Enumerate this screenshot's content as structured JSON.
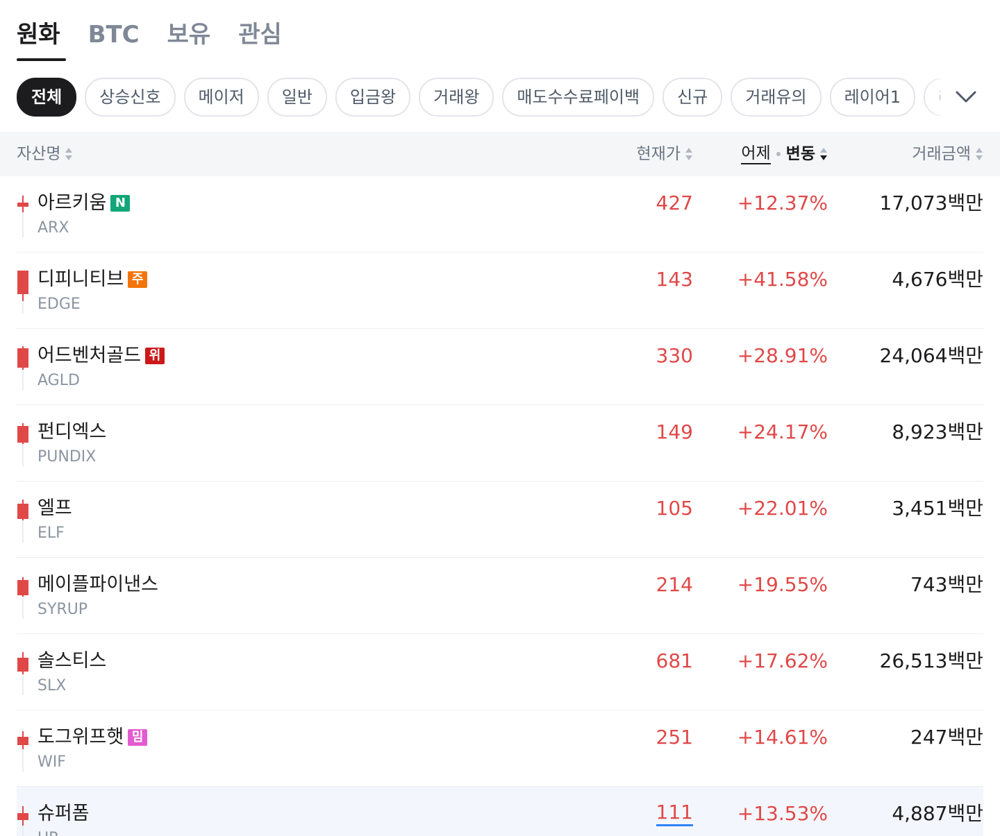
{
  "tabs": [
    {
      "label": "원화",
      "active": true
    },
    {
      "label": "BTC",
      "active": false
    },
    {
      "label": "보유",
      "active": false
    },
    {
      "label": "관심",
      "active": false
    }
  ],
  "chips": [
    {
      "label": "전체",
      "active": true
    },
    {
      "label": "상승신호"
    },
    {
      "label": "메이저"
    },
    {
      "label": "일반"
    },
    {
      "label": "입금왕"
    },
    {
      "label": "거래왕"
    },
    {
      "label": "매도수수료페이백"
    },
    {
      "label": "신규"
    },
    {
      "label": "거래유의"
    },
    {
      "label": "레이어1"
    },
    {
      "label": "레"
    }
  ],
  "table_header": {
    "name": "자산명",
    "price": "현재가",
    "yesterday": "어제",
    "change": "변동",
    "amount": "거래금액"
  },
  "colors": {
    "up": "#e04848",
    "badge_new": "#12a678",
    "badge_caution": "#f2740a",
    "badge_warning": "#cc1a1a",
    "badge_meme": "#e45bd0",
    "underline_blue": "#3182f6"
  },
  "rows": [
    {
      "name": "아르키움",
      "symbol": "ARX",
      "badge": "N",
      "badge_color": "#12a678",
      "price": "427",
      "change": "+12.37%",
      "amount": "17,073백만"
    },
    {
      "name": "디피니티브",
      "symbol": "EDGE",
      "badge": "주",
      "badge_color": "#f2740a",
      "price": "143",
      "change": "+41.58%",
      "amount": "4,676백만"
    },
    {
      "name": "어드벤처골드",
      "symbol": "AGLD",
      "badge": "위",
      "badge_color": "#cc1a1a",
      "price": "330",
      "change": "+28.91%",
      "amount": "24,064백만"
    },
    {
      "name": "펀디엑스",
      "symbol": "PUNDIX",
      "badge": "",
      "badge_color": "",
      "price": "149",
      "change": "+24.17%",
      "amount": "8,923백만"
    },
    {
      "name": "엘프",
      "symbol": "ELF",
      "badge": "",
      "badge_color": "",
      "price": "105",
      "change": "+22.01%",
      "amount": "3,451백만"
    },
    {
      "name": "메이플파이낸스",
      "symbol": "SYRUP",
      "badge": "",
      "badge_color": "",
      "price": "214",
      "change": "+19.55%",
      "amount": "743백만"
    },
    {
      "name": "솔스티스",
      "symbol": "SLX",
      "badge": "",
      "badge_color": "",
      "price": "681",
      "change": "+17.62%",
      "amount": "26,513백만"
    },
    {
      "name": "도그위프햇",
      "symbol": "WIF",
      "badge": "밈",
      "badge_color": "#e45bd0",
      "price": "251",
      "change": "+14.61%",
      "amount": "247백만"
    },
    {
      "name": "슈퍼폼",
      "symbol": "UP",
      "badge": "",
      "badge_color": "",
      "price": "111",
      "change": "+13.53%",
      "amount": "4,887백만"
    }
  ]
}
